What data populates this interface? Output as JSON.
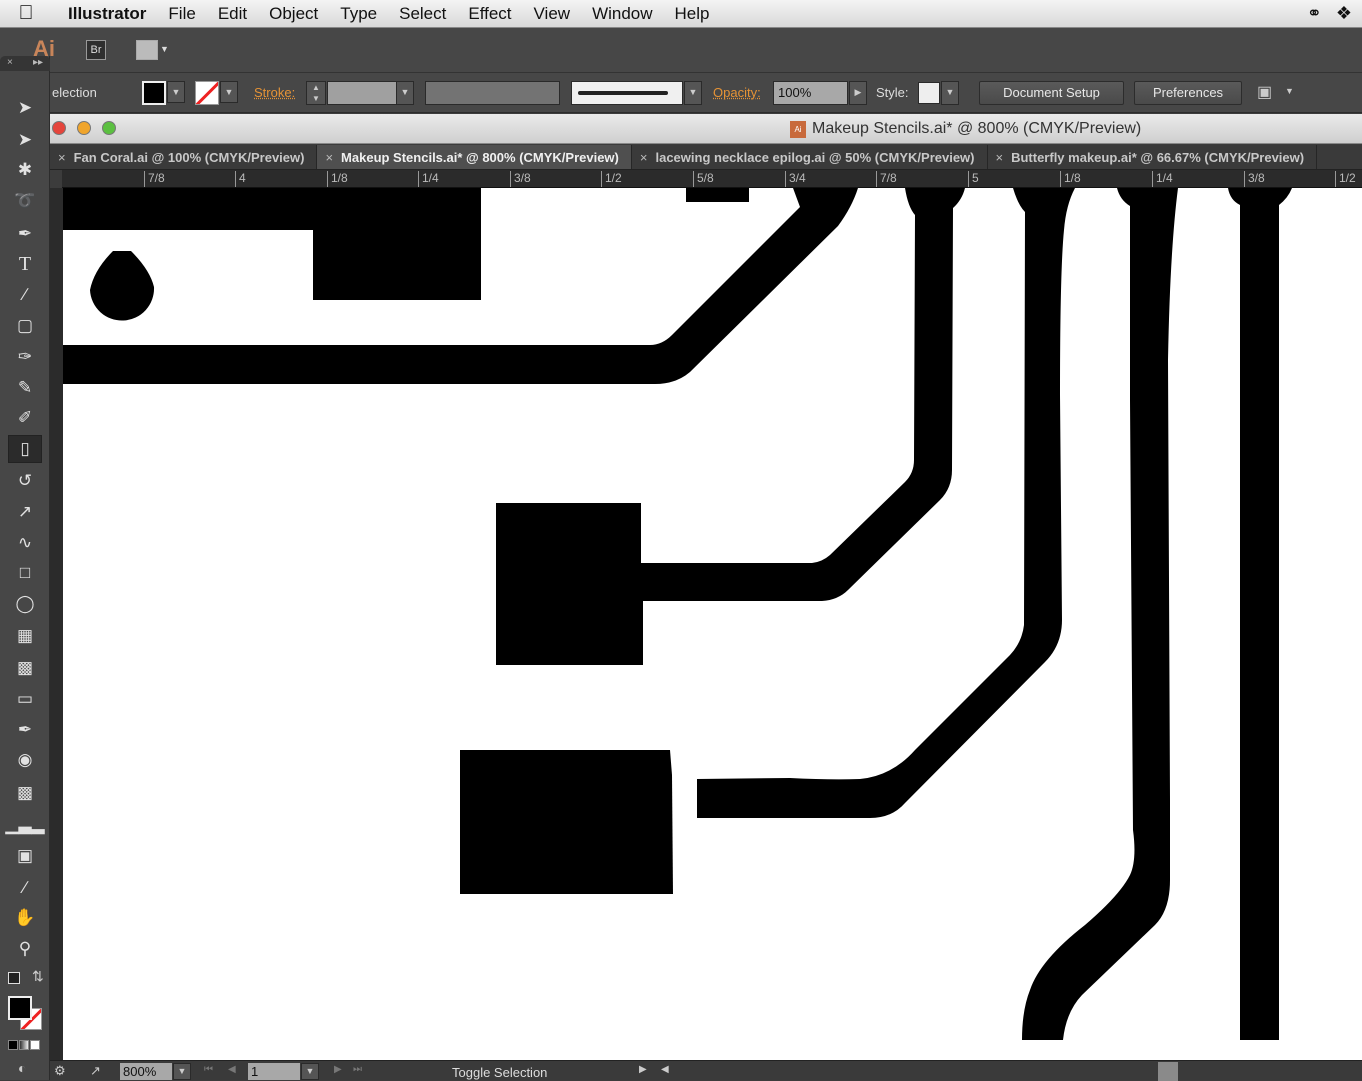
{
  "menubar": {
    "apple_icon": "apple-logo",
    "app_name": "Illustrator",
    "items": [
      "File",
      "Edit",
      "Object",
      "Type",
      "Select",
      "Effect",
      "View",
      "Window",
      "Help"
    ],
    "tray_icons": [
      "creative-cloud-icon",
      "dropbox-icon"
    ]
  },
  "appbar": {
    "logo": "Ai",
    "bridge": "Br"
  },
  "control": {
    "selection_label": "election",
    "fill_color": "#000000",
    "stroke_label": "Stroke:",
    "opacity_label": "Opacity:",
    "opacity_value": "100%",
    "style_label": "Style:",
    "document_setup": "Document Setup",
    "preferences": "Preferences"
  },
  "window": {
    "title": "Makeup Stencils.ai* @ 800% (CMYK/Preview)"
  },
  "tabs": [
    {
      "label": "Fan Coral.ai @ 100% (CMYK/Preview)",
      "active": false
    },
    {
      "label": "Makeup Stencils.ai* @ 800% (CMYK/Preview)",
      "active": true
    },
    {
      "label": "lacewing necklace epilog.ai @ 50% (CMYK/Preview)",
      "active": false
    },
    {
      "label": "Butterfly makeup.ai* @ 66.67% (CMYK/Preview)",
      "active": false
    }
  ],
  "ruler": {
    "labels": [
      "7/8",
      "4",
      "1/8",
      "1/4",
      "3/8",
      "1/2",
      "5/8",
      "3/4",
      "7/8",
      "5",
      "1/8",
      "1/4",
      "3/8",
      "1/2"
    ]
  },
  "tools": [
    "selection",
    "direct-selection",
    "magic-wand",
    "lasso",
    "pen",
    "type",
    "line-segment",
    "rectangle",
    "paintbrush",
    "pencil",
    "blob-brush",
    "eraser",
    "rotate",
    "scale",
    "warp",
    "free-transform",
    "shape-builder",
    "perspective-grid",
    "mesh",
    "gradient",
    "eyedropper",
    "blend",
    "symbol-sprayer",
    "column-graph",
    "artboard",
    "slice",
    "hand",
    "zoom"
  ],
  "status": {
    "zoom_value": "800%",
    "page_value": "1",
    "status_text": "Toggle Selection"
  },
  "colors": {
    "accent": "#e69336",
    "panel": "#474747",
    "canvas": "#ffffff",
    "artwork": "#000000"
  }
}
